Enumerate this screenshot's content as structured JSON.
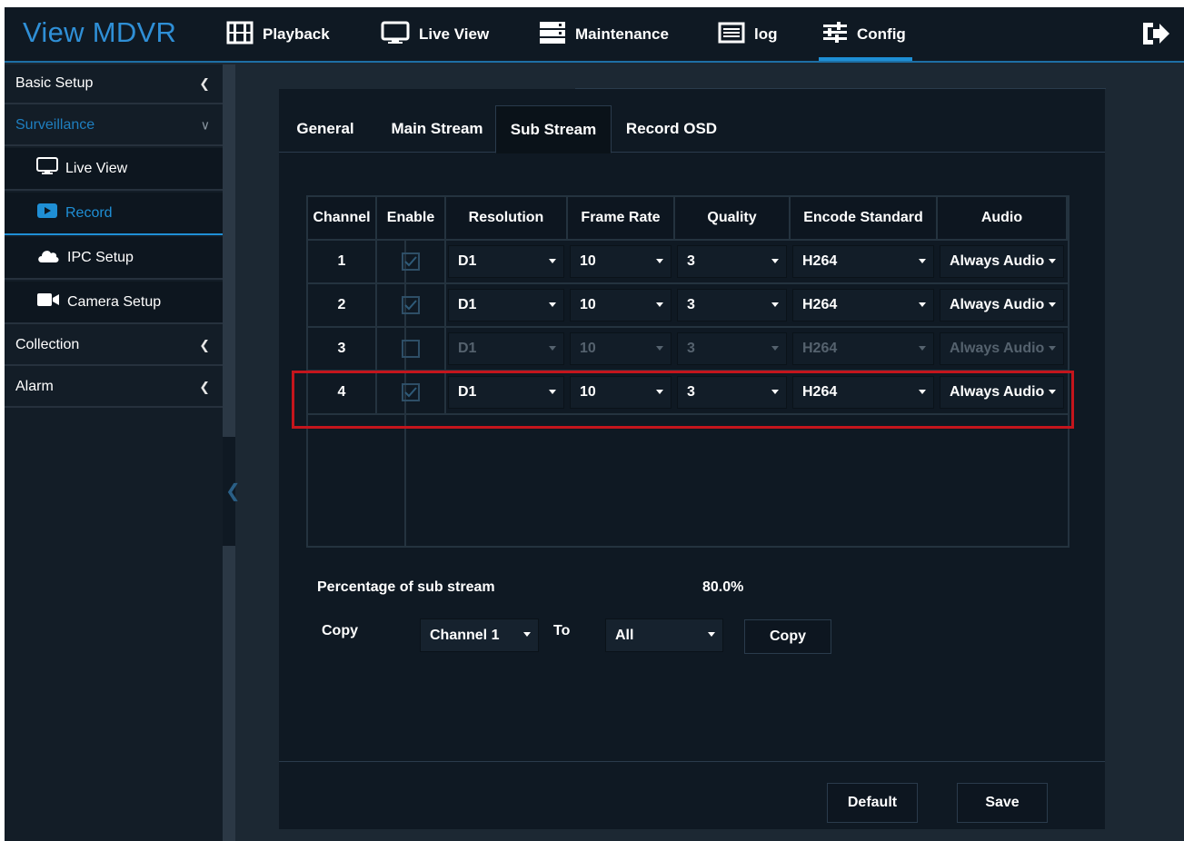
{
  "app": {
    "brand": "View MDVR"
  },
  "nav": [
    {
      "label": "Playback",
      "icon": "film-icon"
    },
    {
      "label": "Live View",
      "icon": "monitor-icon"
    },
    {
      "label": "Maintenance",
      "icon": "server-icon"
    },
    {
      "label": "log",
      "icon": "list-icon"
    },
    {
      "label": "Config",
      "icon": "sliders-icon",
      "active": true
    }
  ],
  "sidebar": {
    "basic_setup": "Basic Setup",
    "surveillance": "Surveillance",
    "live_view": "Live View",
    "record": "Record",
    "ipc_setup": "IPC Setup",
    "camera_setup": "Camera Setup",
    "collection": "Collection",
    "alarm": "Alarm"
  },
  "tabs": [
    "General",
    "Main Stream",
    "Sub Stream",
    "Record OSD"
  ],
  "active_tab": "Sub Stream",
  "table": {
    "headers": [
      "Channel",
      "Enable",
      "Resolution",
      "Frame Rate",
      "Quality",
      "Encode Standard",
      "Audio"
    ],
    "rows": [
      {
        "channel": "1",
        "enabled": true,
        "resolution": "D1",
        "frame_rate": "10",
        "quality": "3",
        "encode": "H264",
        "audio": "Always Audio"
      },
      {
        "channel": "2",
        "enabled": true,
        "resolution": "D1",
        "frame_rate": "10",
        "quality": "3",
        "encode": "H264",
        "audio": "Always Audio"
      },
      {
        "channel": "3",
        "enabled": false,
        "resolution": "D1",
        "frame_rate": "10",
        "quality": "3",
        "encode": "H264",
        "audio": "Always Audio"
      },
      {
        "channel": "4",
        "enabled": true,
        "resolution": "D1",
        "frame_rate": "10",
        "quality": "3",
        "encode": "H264",
        "audio": "Always Audio"
      }
    ]
  },
  "percentage": {
    "label": "Percentage of sub stream",
    "value": "80.0%"
  },
  "copy": {
    "label": "Copy",
    "from": "Channel 1",
    "to_label": "To",
    "to": "All",
    "button": "Copy"
  },
  "footer": {
    "default": "Default",
    "save": "Save"
  },
  "colors": {
    "accent": "#1e8fd5",
    "highlight": "#c4151c",
    "background": "#1c2833"
  }
}
